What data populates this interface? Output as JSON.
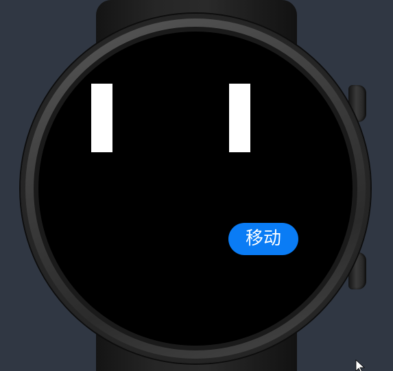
{
  "screen": {
    "move_button": {
      "label": "移动",
      "color": "#0a7cf5"
    },
    "bars": [
      {
        "name": "left-bar",
        "color": "#ffffff"
      },
      {
        "name": "right-bar",
        "color": "#ffffff"
      }
    ],
    "background": "#000000"
  },
  "page": {
    "background": "#303743"
  }
}
